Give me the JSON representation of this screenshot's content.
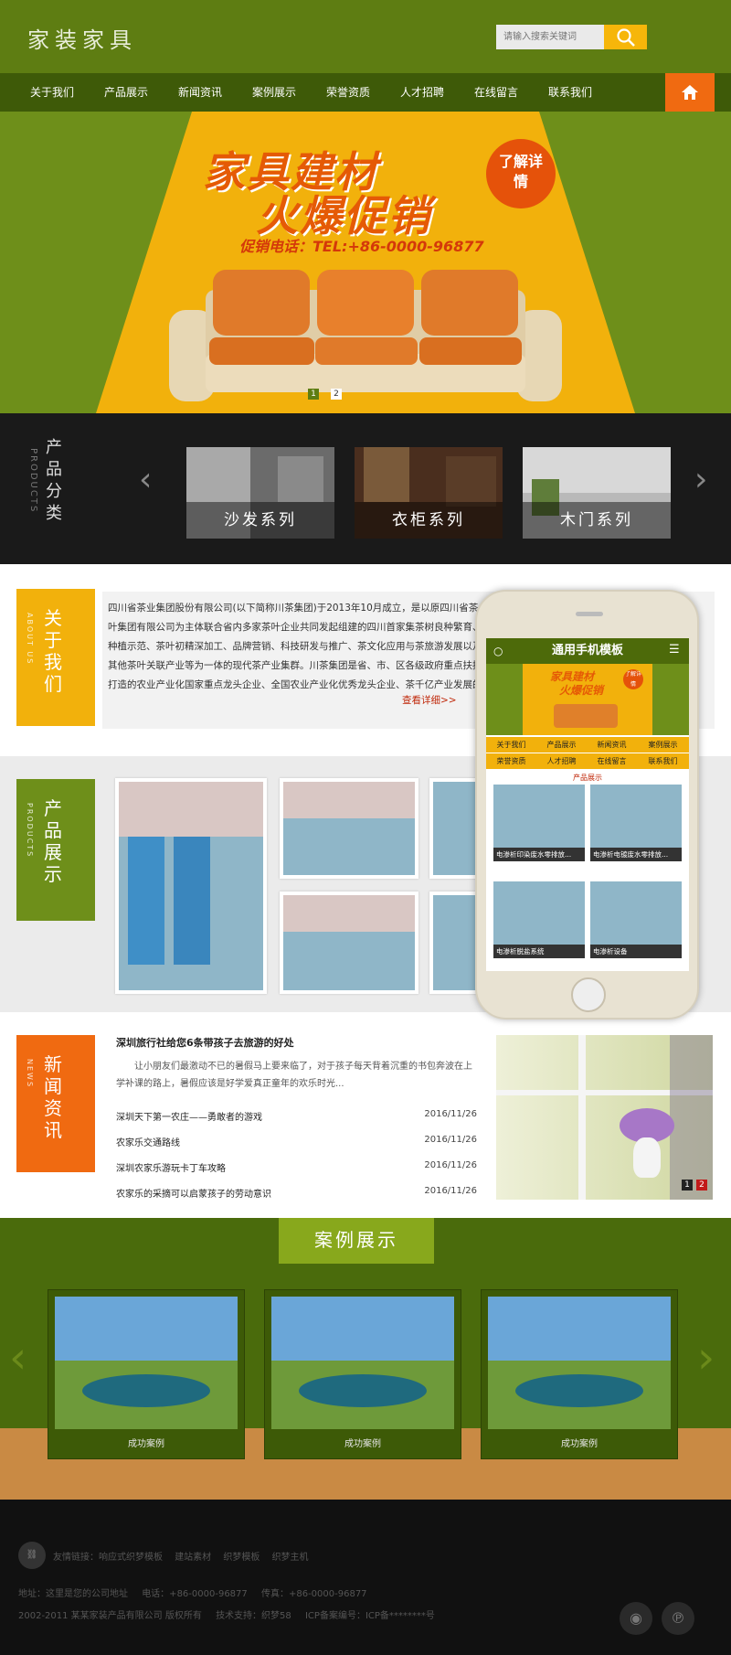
{
  "header": {
    "logo": "家装家具",
    "search_placeholder": "请输入搜索关键词"
  },
  "nav": {
    "items": [
      "关于我们",
      "产品展示",
      "新闻资讯",
      "案例展示",
      "荣誉资质",
      "人才招聘",
      "在线留言",
      "联系我们"
    ]
  },
  "banner": {
    "headline_1": "家具建材",
    "headline_2": "火爆促销",
    "phone": "促销电话：TEL:+86-0000-96877",
    "badge": "了解详情",
    "dots": [
      "1",
      "2"
    ]
  },
  "categories": {
    "title": "产品分类",
    "title_en": "PRODUCTS",
    "items": [
      "沙发系列",
      "衣柜系列",
      "木门系列"
    ]
  },
  "about": {
    "title": "关于我们",
    "title_en": "ABOUT US",
    "text": "四川省茶业集团股份有限公司(以下简称川茶集团)于2013年10月成立，是以原四川省茶叶集团有限公司为主体联合省内多家茶叶企业共同发起组建的四川首家集茶树良种繁育、种植示范、茶叶初精深加工、品牌营销、科技研发与推广、茶文化应用与茶旅游发展以及其他茶叶关联产业等为一体的现代茶产业集群。川茶集团是省、市、区各级政府重点扶持打造的农业产业化国家重点龙头企业、全国农业产业化优秀龙头企业、茶千亿产业发展的排头兵企业。近年来，集团在翠屏区邱场、...",
    "more": "查看详细>>"
  },
  "products": {
    "title": "产品展示",
    "title_en": "PRODUCTS"
  },
  "news": {
    "title": "新闻资讯",
    "title_en": "NEWS",
    "headline": "深圳旅行社给您6条带孩子去旅游的好处",
    "summary": "让小朋友们最激动不已的暑假马上要来临了，对于孩子每天背着沉重的书包奔波在上学补课的路上，暑假应该是好学爱真正童年的欢乐时光...",
    "items": [
      {
        "title": "深圳天下第一农庄——勇敢者的游戏",
        "date": "2016/11/26"
      },
      {
        "title": "农家乐交通路线",
        "date": "2016/11/26"
      },
      {
        "title": "深圳农家乐游玩卡丁车攻略",
        "date": "2016/11/26"
      },
      {
        "title": "农家乐的采摘可以启蒙孩子的劳动意识",
        "date": "2016/11/26"
      }
    ],
    "slider_dots": [
      "1",
      "2"
    ]
  },
  "cases": {
    "title": "案例展示",
    "items": [
      "成功案例",
      "成功案例",
      "成功案例"
    ]
  },
  "phone": {
    "title": "通用手机模板",
    "banner_1": "家具建材",
    "banner_2": "火爆促销",
    "badge": "了解详情",
    "nav": [
      "关于我们",
      "产品展示",
      "新闻资讯",
      "案例展示",
      "荣誉资质",
      "人才招聘",
      "在线留言",
      "联系我们"
    ],
    "section": "产品展示",
    "products": [
      "电渗析印染废水零排放...",
      "电渗析电镀废水零排放...",
      "电渗析脱盐系统",
      "电渗析设备"
    ]
  },
  "footer": {
    "links_label": "友情链接：",
    "links": [
      "响应式织梦模板",
      "建站素材",
      "织梦模板",
      "织梦主机"
    ],
    "address": "地址：这里是您的公司地址",
    "tel": "电话：+86-0000-96877",
    "fax": "传真：+86-0000-96877",
    "copyright": "2002-2011 某某家装产品有限公司 版权所有",
    "support": "技术支持：织梦58",
    "icp": "ICP备案编号：ICP备********号"
  },
  "colors": {
    "brand_green": "#5e7d12",
    "nav_green": "#3e5a08",
    "accent_orange": "#f06a11",
    "accent_yellow": "#f2b10c"
  }
}
